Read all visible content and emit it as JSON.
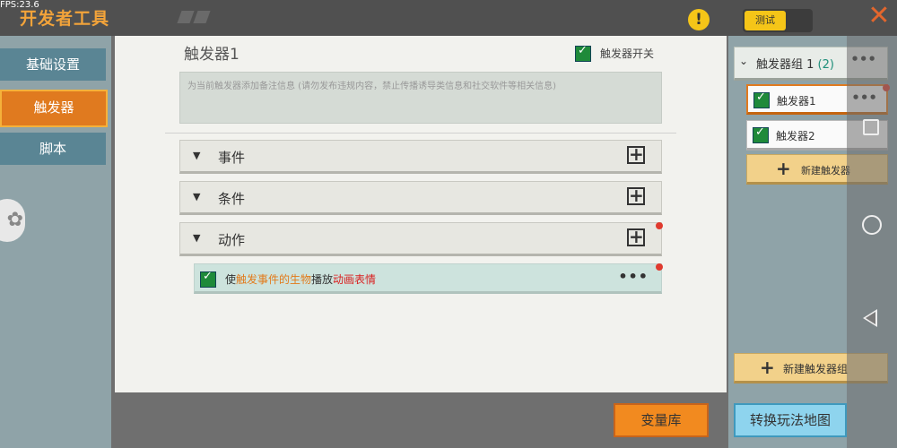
{
  "status": {
    "fps": "FPS:23.6"
  },
  "header": {
    "title": "开发者工具",
    "warning_icon": "exclamation-icon",
    "toggle_label": "测试",
    "close_icon": "close-x-icon",
    "accent": "#f2a33a"
  },
  "sidebar": {
    "items": [
      {
        "label": "基础设置"
      },
      {
        "label": "触发器"
      },
      {
        "label": "脚本"
      }
    ]
  },
  "main": {
    "title": "触发器1",
    "switch_label": "触发器开关",
    "remark_placeholder": "为当前触发器添加备注信息 (请勿发布违规内容，禁止传播诱导类信息和社交软件等相关信息)",
    "sections": [
      {
        "label": "事件"
      },
      {
        "label": "条件"
      },
      {
        "label": "动作"
      }
    ],
    "action": {
      "part1": "使",
      "part2": "触发事件的生物",
      "part3": "播放",
      "part4": "动画表情"
    }
  },
  "right": {
    "group": {
      "name": "触发器组 1",
      "count": "(2)"
    },
    "triggers": [
      {
        "label": "触发器1"
      },
      {
        "label": "触发器2"
      }
    ],
    "new_trigger": "新建触发器",
    "new_group": "新建触发器组"
  },
  "footer": {
    "var_lib": "变量库",
    "convert": "转换玩法地图"
  }
}
